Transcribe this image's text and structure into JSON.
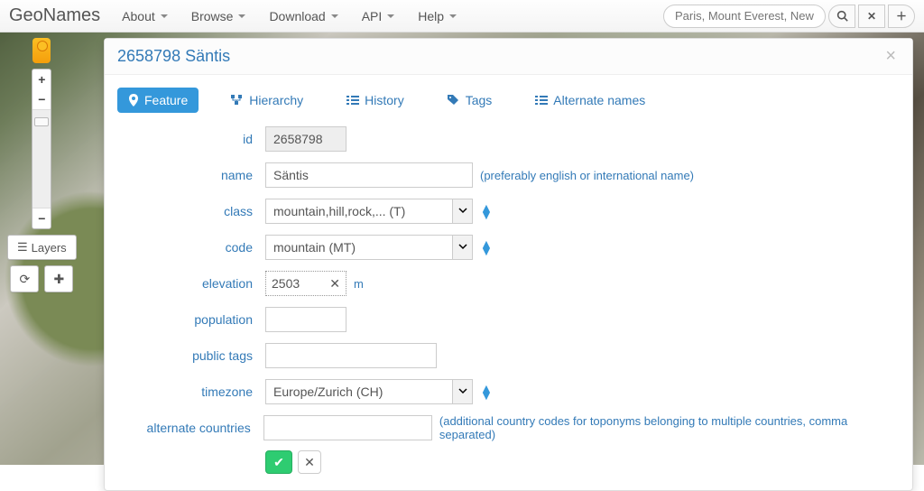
{
  "app": {
    "brand": "GeoNames"
  },
  "nav": {
    "items": [
      {
        "label": "About"
      },
      {
        "label": "Browse"
      },
      {
        "label": "Download"
      },
      {
        "label": "API"
      },
      {
        "label": "Help"
      }
    ],
    "search_placeholder": "Paris, Mount Everest, New York"
  },
  "map_controls": {
    "layers_label": "Layers"
  },
  "panel": {
    "id": "2658798",
    "name": "Säntis",
    "title": "2658798 Säntis",
    "tabs": [
      {
        "label": "Feature",
        "icon": "pin-icon",
        "active": true
      },
      {
        "label": "Hierarchy",
        "icon": "tree-icon",
        "active": false
      },
      {
        "label": "History",
        "icon": "list-icon",
        "active": false
      },
      {
        "label": "Tags",
        "icon": "tags-icon",
        "active": false
      },
      {
        "label": "Alternate names",
        "icon": "list-icon",
        "active": false
      }
    ],
    "form": {
      "labels": {
        "id": "id",
        "name": "name",
        "class": "class",
        "code": "code",
        "elevation": "elevation",
        "population": "population",
        "public_tags": "public tags",
        "timezone": "timezone",
        "alternate_countries": "alternate countries"
      },
      "values": {
        "id": "2658798",
        "name": "Säntis",
        "class": "mountain,hill,rock,... (T)",
        "code": "mountain (MT)",
        "elevation": "2503",
        "elevation_unit": "m",
        "population": "",
        "public_tags": "",
        "timezone": "Europe/Zurich (CH)",
        "alternate_countries": ""
      },
      "hints": {
        "name": "(preferably english or international name)",
        "alternate_countries": "(additional country codes for toponyms belonging to multiple countries, comma separated)"
      }
    }
  }
}
